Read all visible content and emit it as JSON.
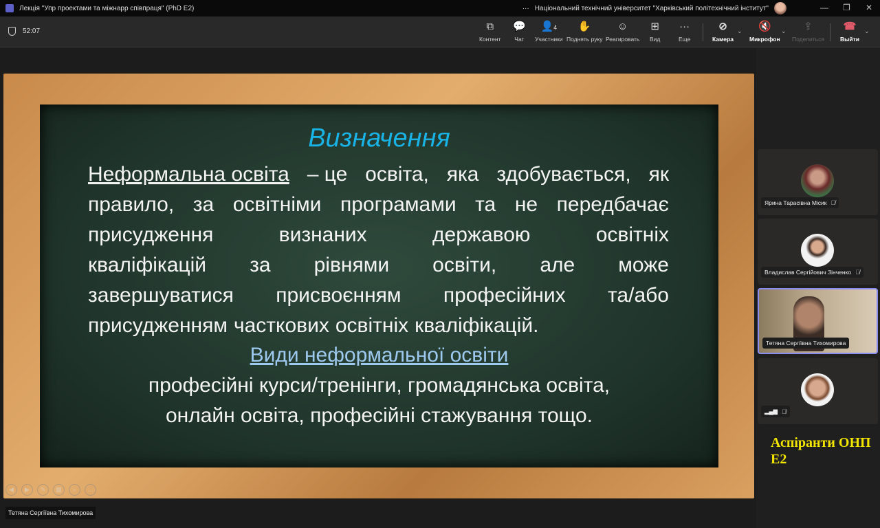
{
  "window": {
    "title": "Лекція \"Упр проектами та міжнарр співпраця\" (PhD E2)",
    "org": "Національний технічний університет \"Харківський політехнічний інститут\"",
    "more": "···"
  },
  "toolbar": {
    "timer": "52:07",
    "buttons": [
      {
        "label": "Контент",
        "icon": "share-content-icon",
        "glyph": "⧉"
      },
      {
        "label": "Чат",
        "icon": "chat-icon",
        "glyph": "💬"
      },
      {
        "label": "Участники",
        "icon": "participants-icon",
        "glyph": "👤",
        "badge": "4"
      },
      {
        "label": "Поднять руку",
        "icon": "raise-hand-icon",
        "glyph": "✋"
      },
      {
        "label": "Реагировать",
        "icon": "react-icon",
        "glyph": "☺"
      },
      {
        "label": "Вид",
        "icon": "view-icon",
        "glyph": "⊞"
      },
      {
        "label": "Еще",
        "icon": "more-icon",
        "glyph": "···"
      },
      {
        "label": "Камера",
        "icon": "camera-off-icon",
        "glyph": "⊘"
      },
      {
        "label": "Микрофон",
        "icon": "mic-off-icon",
        "glyph": "🔇"
      },
      {
        "label": "Поделиться",
        "icon": "share-icon",
        "glyph": "⇪"
      },
      {
        "label": "Выйти",
        "icon": "hang-up-icon",
        "glyph": "☎"
      }
    ]
  },
  "slide": {
    "title": "Визначення",
    "term": "Неформальна освіта ",
    "lines": [
      [
        "– це",
        "освіта,",
        "яка",
        "здобувається,",
        "як"
      ],
      [
        "правило,",
        "за",
        "освітніми",
        "програмами",
        "та",
        "не",
        "передбачає"
      ],
      [
        "присудження",
        "визнаних",
        "державою",
        "освітніх"
      ],
      [
        "кваліфікацій",
        "за",
        "рівнями",
        "освіти,",
        "але",
        "може"
      ],
      [
        "завершуватися",
        "присвоєнням",
        "професійних",
        "та/або"
      ],
      [
        "присудженням",
        "часткових",
        "освітніх",
        "кваліфікацій."
      ]
    ],
    "types_title": "Види неформальної освіти",
    "types_line1": "професійні курси/тренінги, громадянська освіта,",
    "types_line2": "онлайн освіта, професійні стажування тощо."
  },
  "presenter": "Тетяна Сергіївна Тихомирова",
  "participants": [
    {
      "name": "Ярина Тарасівна Місик",
      "muted": true
    },
    {
      "name": "Владислав Сергійович Зінченко",
      "muted": true
    },
    {
      "name": "Тетяна Сергіївна Тихомирова",
      "muted": false
    },
    {
      "name": "",
      "muted": true
    }
  ],
  "group_note_1": "Аспіранти ОНП",
  "group_note_2": "Е2",
  "colors": {
    "accent": "#5b5fc7",
    "title": "#19b3e6",
    "note": "#f2e600"
  }
}
